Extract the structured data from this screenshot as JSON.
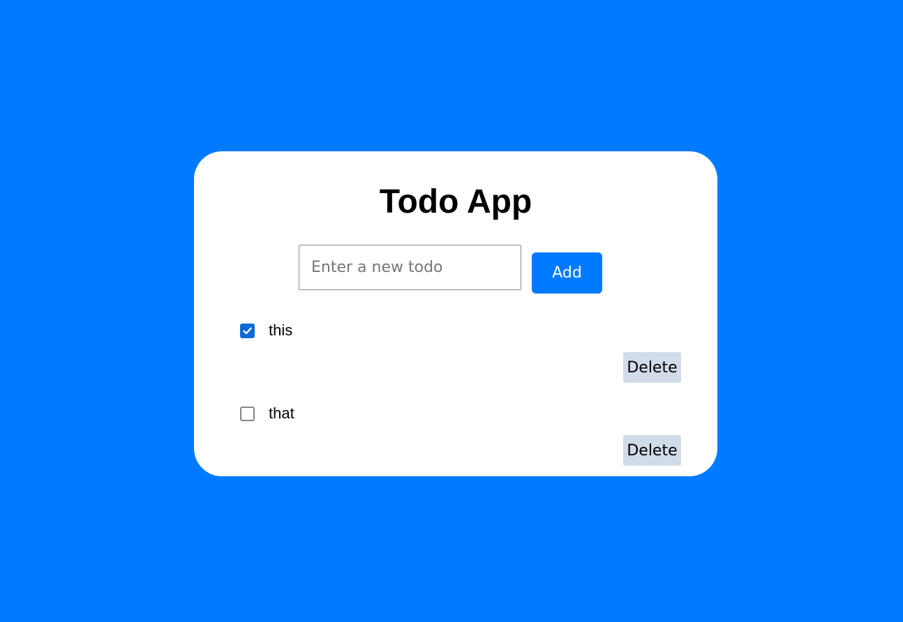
{
  "app": {
    "title": "Todo App"
  },
  "new_todo": {
    "placeholder": "Enter a new todo",
    "value": "",
    "add_label": "Add"
  },
  "todos": [
    {
      "text": "this",
      "done": true,
      "delete_label": "Delete"
    },
    {
      "text": "that",
      "done": false,
      "delete_label": "Delete"
    }
  ],
  "colors": {
    "background": "#007bff",
    "card": "#ffffff",
    "accent": "#007bff",
    "checkbox_checked": "#0b6bd3",
    "delete_button": "#d1dcea"
  }
}
